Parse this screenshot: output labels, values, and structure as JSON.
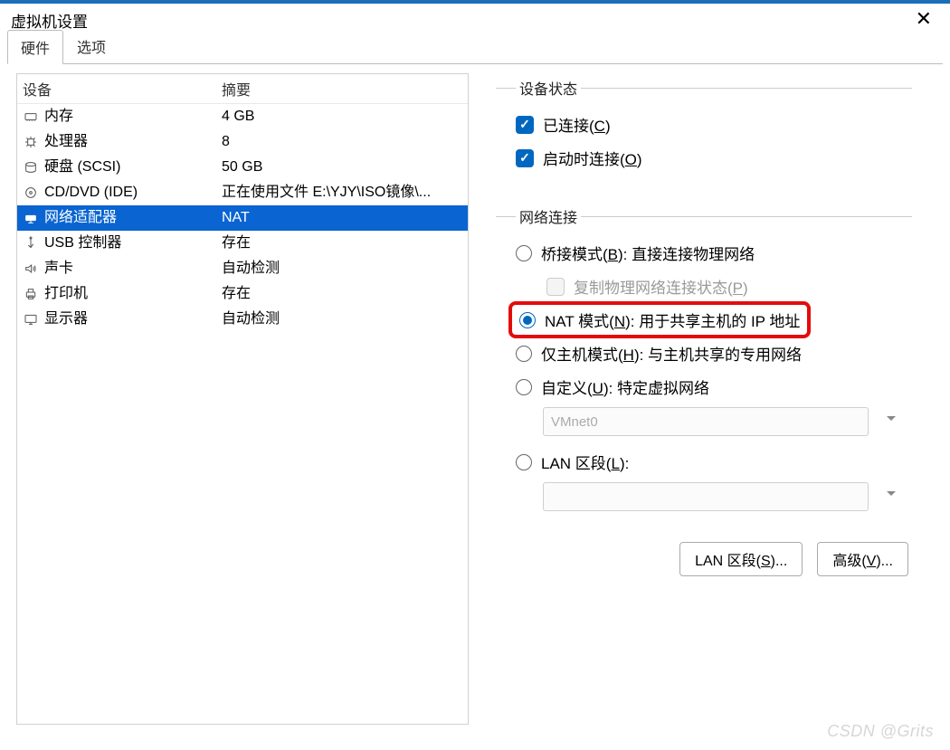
{
  "window": {
    "title": "虚拟机设置"
  },
  "tabs": {
    "hardware": "硬件",
    "options": "选项"
  },
  "cols": {
    "device": "设备",
    "summary": "摘要"
  },
  "rows": {
    "memory": {
      "label": "内存",
      "summary": "4 GB"
    },
    "cpu": {
      "label": "处理器",
      "summary": "8"
    },
    "hdd": {
      "label": "硬盘 (SCSI)",
      "summary": "50 GB"
    },
    "cddvd": {
      "label": "CD/DVD (IDE)",
      "summary": "正在使用文件 E:\\YJY\\ISO镜像\\..."
    },
    "net": {
      "label": "网络适配器",
      "summary": "NAT"
    },
    "usb": {
      "label": "USB 控制器",
      "summary": "存在"
    },
    "sound": {
      "label": "声卡",
      "summary": "自动检测"
    },
    "printer": {
      "label": "打印机",
      "summary": "存在"
    },
    "display": {
      "label": "显示器",
      "summary": "自动检测"
    }
  },
  "devstate": {
    "legend": "设备状态",
    "connected_pre": "已连接(",
    "connected_hot": "C",
    "connected_post": ")",
    "poweron_pre": "启动时连接(",
    "poweron_hot": "O",
    "poweron_post": ")"
  },
  "netconn": {
    "legend": "网络连接",
    "bridge_pre": "桥接模式(",
    "bridge_hot": "B",
    "bridge_post": "): 直接连接物理网络",
    "replicate_pre": "复制物理网络连接状态(",
    "replicate_hot": "P",
    "replicate_post": ")",
    "nat_pre": "NAT 模式(",
    "nat_hot": "N",
    "nat_post": "): 用于共享主机的 IP 地址",
    "host_pre": "仅主机模式(",
    "host_hot": "H",
    "host_post": "): 与主机共享的专用网络",
    "custom_pre": "自定义(",
    "custom_hot": "U",
    "custom_post": "): 特定虚拟网络",
    "vmnet0": "VMnet0",
    "lanseg_pre": "LAN 区段(",
    "lanseg_hot": "L",
    "lanseg_post": "):"
  },
  "buttons": {
    "lanseg_pre": "LAN 区段(",
    "lanseg_hot": "S",
    "lanseg_post": ")...",
    "adv_pre": "高级(",
    "adv_hot": "V",
    "adv_post": ")..."
  },
  "watermark": "CSDN @Grits"
}
